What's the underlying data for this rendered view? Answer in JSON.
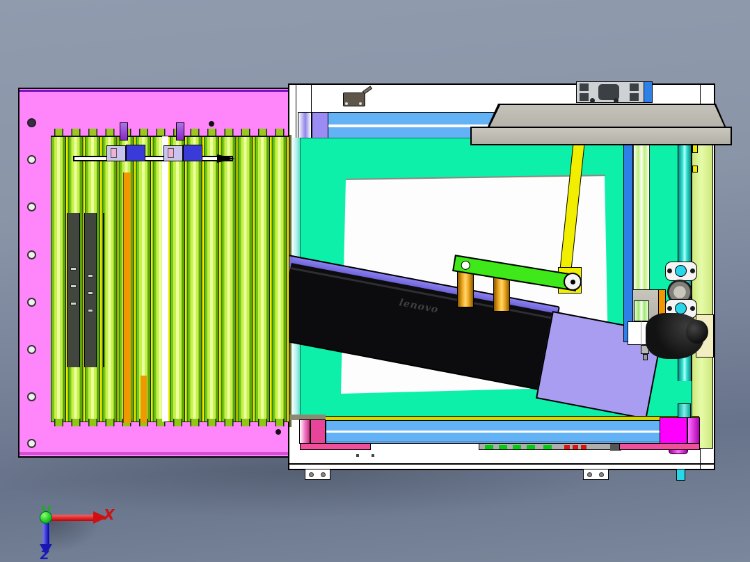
{
  "scene": {
    "title": "3D CAD assembly render - machine top view",
    "view_orientation": "top",
    "brand_text": "lenovo",
    "axis_labels": {
      "x": "X",
      "z": "Z"
    }
  },
  "colors": {
    "background_top": "#909bae",
    "background_bottom": "#67738a",
    "panel_pink": "#ff85fb",
    "panel_pink_edge": "#7a10c0",
    "roller_green_light": "#d8fa6a",
    "roller_green_dark": "#3f9c00",
    "accent_yellow": "#f2e800",
    "accent_orange": "#f09800",
    "deck_teal": "#0df0aa",
    "bars_blue": "#64b2f6",
    "post_blue": "#2f7fe8",
    "plate_gray": "#bdbab1",
    "plate_lavender": "#a89df0",
    "laptop_black": "#0c0c0e",
    "laptop_edge_blue": "#7a70e8",
    "link_green": "#3fe818",
    "arm_yellow": "#f2ee00",
    "magenta": "#ff00ff",
    "pink_bar": "#ef4f9b",
    "pale_green_panel": "#dcf79d",
    "cyan_accent": "#29d6ea",
    "axis_x_red": "#d01010",
    "axis_z_blue": "#1818c0",
    "axis_origin_green": "#22cc22"
  },
  "components": [
    "pink-feed-panel",
    "screw-holes",
    "green-rollers",
    "roller-tabs",
    "slide-bar",
    "carriage-blocks",
    "purple-clips",
    "conveyor-deck",
    "white-sheet",
    "laptop-panel",
    "lavender-plate",
    "nozzle",
    "gray-gantry-plate",
    "gray-gantry-bar",
    "aluminum-extrusion",
    "sensor-box",
    "yellow-crank-arm",
    "green-link",
    "gold-standoffs",
    "blue-guide-bars",
    "blue-post",
    "cyan-rod",
    "glass-rod",
    "bearing-blocks",
    "pneumatic-elbow",
    "pale-side-panel",
    "magenta-block",
    "pink-bars",
    "led-strip",
    "foot-brackets",
    "coordinate-triad"
  ]
}
